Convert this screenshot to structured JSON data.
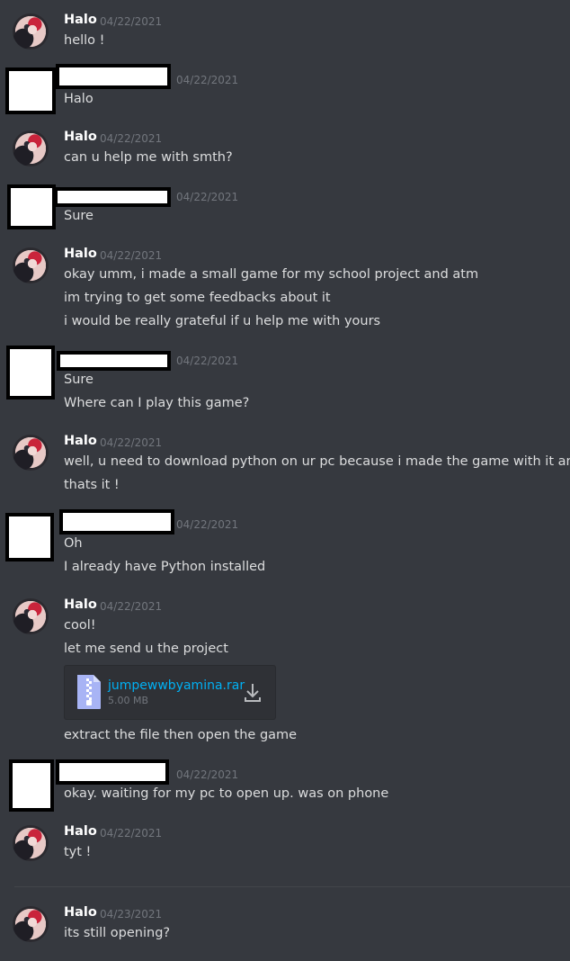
{
  "messages": [
    {
      "author": "Halo",
      "timestamp": "04/22/2021",
      "lines": [
        "hello !"
      ]
    },
    {
      "author": "",
      "timestamp": "04/22/2021",
      "lines": [
        "Halo"
      ]
    },
    {
      "author": "Halo",
      "timestamp": "04/22/2021",
      "lines": [
        "can u help me with smth?"
      ]
    },
    {
      "author": "",
      "timestamp": "04/22/2021",
      "lines": [
        "Sure"
      ]
    },
    {
      "author": "Halo",
      "timestamp": "04/22/2021",
      "lines": [
        "okay umm, i made a small game for my school project and atm",
        "im trying to get some feedbacks about it",
        "i would be really grateful if u help me with yours"
      ]
    },
    {
      "author": "",
      "timestamp": "04/22/2021",
      "lines": [
        "Sure",
        "Where can I play this game?"
      ]
    },
    {
      "author": "Halo",
      "timestamp": "04/22/2021",
      "lines": [
        "well, u need to download python on ur pc because i made the game with it andd",
        "thats it !"
      ]
    },
    {
      "author": "",
      "timestamp": "04/22/2021",
      "lines": [
        "Oh",
        "I already have Python installed"
      ]
    },
    {
      "author": "Halo",
      "timestamp": "04/22/2021",
      "lines": [
        "cool!",
        "let me send u the project",
        "extract the file then open the game"
      ],
      "attachment": {
        "name": "jumpewwbyamina.rar",
        "size": "5.00 MB",
        "icon": "zip-file-icon",
        "action_icon": "download-icon"
      }
    },
    {
      "author": "",
      "timestamp": "04/22/2021",
      "lines": [
        "okay. waiting for my pc to open up. was on phone"
      ]
    },
    {
      "author": "Halo",
      "timestamp": "04/22/2021",
      "lines": [
        "tyt !"
      ]
    },
    {
      "author": "Halo",
      "timestamp": "04/23/2021",
      "lines": [
        "its still opening?"
      ]
    }
  ],
  "colors": {
    "background": "#36393f",
    "text": "#dcddde",
    "author": "#ffffff",
    "timestamp": "#72767d",
    "link": "#00b0f4"
  }
}
